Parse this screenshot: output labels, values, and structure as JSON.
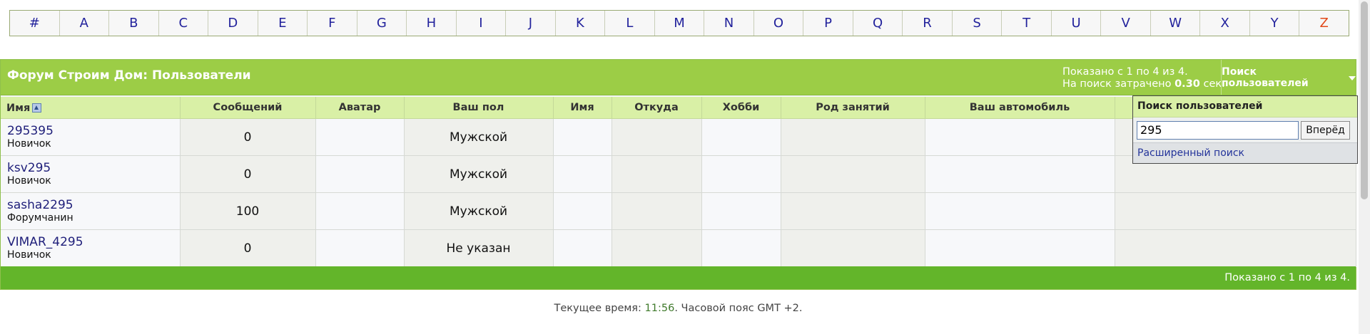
{
  "letters": [
    "#",
    "A",
    "B",
    "C",
    "D",
    "E",
    "F",
    "G",
    "H",
    "I",
    "J",
    "K",
    "L",
    "M",
    "N",
    "O",
    "P",
    "Q",
    "R",
    "S",
    "T",
    "U",
    "V",
    "W",
    "X",
    "Y",
    "Z"
  ],
  "active_letter": "Z",
  "header": {
    "title": "Форум Строим Дом: Пользователи",
    "results_line1": "Показано с 1 по 4 из 4.",
    "results_line2_prefix": "На поиск затрачено",
    "results_time": "0.30",
    "results_line2_suffix": "сек.",
    "search_toggle_label": "Поиск пользователей"
  },
  "columns": [
    "Имя",
    "Сообщений",
    "Аватар",
    "Ваш пол",
    "Имя",
    "Откуда",
    "Хобби",
    "Род занятий",
    "Ваш автомобиль",
    ""
  ],
  "members": [
    {
      "nick": "295395",
      "rank": "Новичок",
      "posts": "0",
      "gender": "Мужской"
    },
    {
      "nick": "ksv295",
      "rank": "Новичок",
      "posts": "0",
      "gender": "Мужской"
    },
    {
      "nick": "sasha2295",
      "rank": "Форумчанин",
      "posts": "100",
      "gender": "Мужской"
    },
    {
      "nick": "VIMAR_4295",
      "rank": "Новичок",
      "posts": "0",
      "gender": "Не указан"
    }
  ],
  "footer": {
    "results": "Показано с 1 по 4 из 4."
  },
  "search_popup": {
    "title": "Поиск пользователей",
    "value": "295",
    "go_label": "Вперёд",
    "advanced_label": "Расширенный поиск"
  },
  "time": {
    "prefix": "Текущее время:",
    "value": "11:56",
    "suffix": ". Часовой пояс GMT +2."
  },
  "colors": {
    "header_green": "#9ccd46",
    "footer_green": "#63b52a",
    "column_header": "#d9f0a6",
    "active_letter": "#e2491a"
  }
}
